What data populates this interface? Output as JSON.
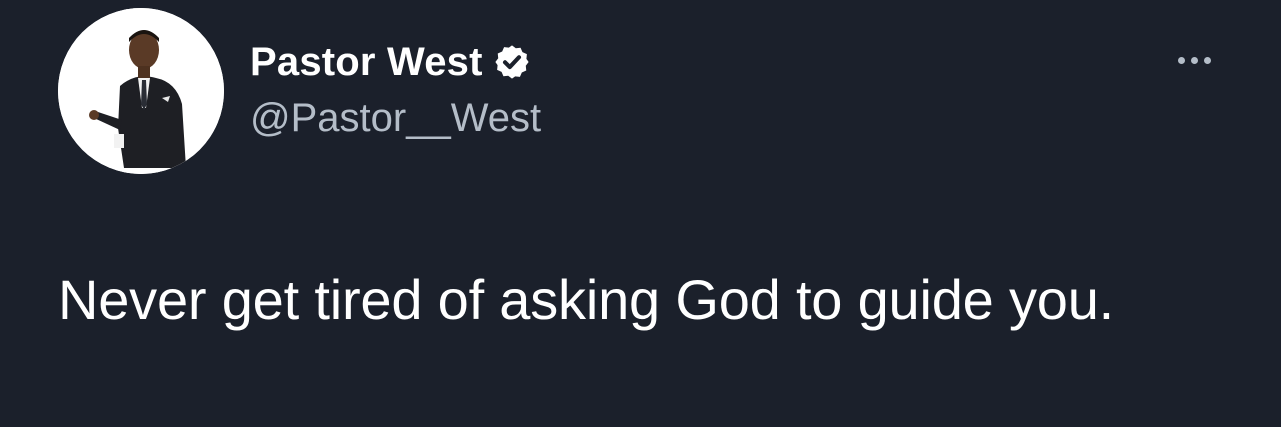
{
  "tweet": {
    "author": {
      "display_name": "Pastor West",
      "handle": "@Pastor__West",
      "verified": true,
      "verified_icon": "verified-badge-icon",
      "avatar": "profile-photo-man-in-suit"
    },
    "more_icon": "more-horizontal-icon",
    "text": "Never get tired of asking God to guide you."
  },
  "colors": {
    "background": "#1b202b",
    "primary_text": "#ffffff",
    "secondary_text": "#b4bdc8"
  }
}
